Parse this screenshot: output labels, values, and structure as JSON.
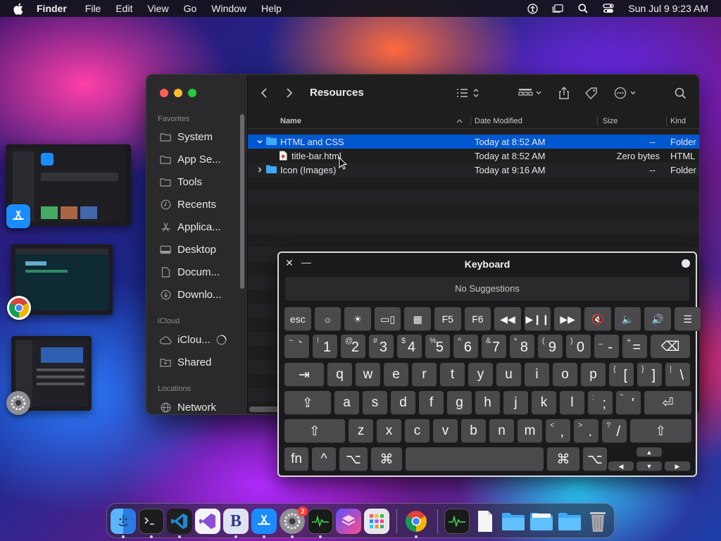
{
  "menubar": {
    "app_name": "Finder",
    "items": [
      "File",
      "Edit",
      "View",
      "Go",
      "Window",
      "Help"
    ],
    "clock": "Sun Jul 9  9:23 AM",
    "status_icons": [
      "accessibility-icon",
      "stage-manager-icon",
      "spotlight-icon",
      "control-center-icon"
    ]
  },
  "finder": {
    "title": "Resources",
    "sidebar": {
      "favorites_label": "Favorites",
      "favorites": [
        {
          "label": "System",
          "icon": "folder-icon"
        },
        {
          "label": "App Se...",
          "icon": "folder-icon"
        },
        {
          "label": "Tools",
          "icon": "folder-icon"
        },
        {
          "label": "Recents",
          "icon": "clock-icon"
        },
        {
          "label": "Applica...",
          "icon": "applications-icon"
        },
        {
          "label": "Desktop",
          "icon": "desktop-icon"
        },
        {
          "label": "Docum...",
          "icon": "document-icon"
        },
        {
          "label": "Downlo...",
          "icon": "download-icon"
        }
      ],
      "icloud_label": "iCloud",
      "icloud": [
        {
          "label": "iClou...",
          "icon": "cloud-icon"
        },
        {
          "label": "Shared",
          "icon": "shared-folder-icon"
        }
      ],
      "locations_label": "Locations",
      "locations": [
        {
          "label": "Network",
          "icon": "globe-icon"
        }
      ]
    },
    "columns": {
      "name": "Name",
      "date": "Date Modified",
      "size": "Size",
      "kind": "Kind"
    },
    "rows": [
      {
        "name": "HTML and CSS",
        "date": "Today at 8:52 AM",
        "size": "--",
        "kind": "Folder"
      },
      {
        "name": "title-bar.html",
        "date": "Today at 8:52 AM",
        "size": "Zero bytes",
        "kind": "HTML"
      },
      {
        "name": "Icon (Images)",
        "date": "Today at 9:16 AM",
        "size": "--",
        "kind": "Folder"
      }
    ]
  },
  "keyboard": {
    "title": "Keyboard",
    "suggestions": "No Suggestions",
    "fn_row": [
      "esc",
      "☼",
      "☀",
      "▭▯",
      "▦",
      "F5",
      "F6",
      "◀◀",
      "▶❙❙",
      "▶▶",
      "🔇",
      "🔈",
      "🔊",
      "☰"
    ],
    "number_row": [
      {
        "sub": "~",
        "main": "`"
      },
      {
        "sub": "!",
        "main": "1"
      },
      {
        "sub": "@",
        "main": "2"
      },
      {
        "sub": "#",
        "main": "3"
      },
      {
        "sub": "$",
        "main": "4"
      },
      {
        "sub": "%",
        "main": "5"
      },
      {
        "sub": "^",
        "main": "6"
      },
      {
        "sub": "&",
        "main": "7"
      },
      {
        "sub": "*",
        "main": "8"
      },
      {
        "sub": "(",
        "main": "9"
      },
      {
        "sub": ")",
        "main": "0"
      },
      {
        "sub": "_",
        "main": "-"
      },
      {
        "sub": "+",
        "main": "="
      }
    ],
    "delete": "⌫",
    "tab": "⇥",
    "qwerty_row": [
      "q",
      "w",
      "e",
      "r",
      "t",
      "y",
      "u",
      "i",
      "o",
      "p"
    ],
    "qwerty_punct": [
      {
        "sub": "{",
        "main": "["
      },
      {
        "sub": "}",
        "main": "]"
      },
      {
        "sub": "|",
        "main": "\\"
      }
    ],
    "caps": "⇪",
    "asdf_row": [
      "a",
      "s",
      "d",
      "f",
      "g",
      "h",
      "j",
      "k",
      "l"
    ],
    "asdf_punct": [
      {
        "sub": ":",
        "main": ";"
      },
      {
        "sub": "\"",
        "main": "'"
      }
    ],
    "return": "⏎",
    "shift": "⇧",
    "zxcv_row": [
      "z",
      "x",
      "c",
      "v",
      "b",
      "n",
      "m"
    ],
    "zxcv_punct": [
      {
        "sub": "<",
        "main": ","
      },
      {
        "sub": ">",
        "main": "."
      },
      {
        "sub": "?",
        "main": "/"
      }
    ],
    "fn": "fn",
    "control": "^",
    "option": "⌥",
    "command": "⌘",
    "arrows": {
      "up": "▲",
      "left": "◀",
      "down": "▼",
      "right": "▶"
    }
  },
  "dock": {
    "apps": [
      "Finder",
      "Terminal",
      "VS Code",
      "Visual Studio",
      "BBEdit",
      "App Store",
      "System Settings",
      "Activity Monitor",
      "Shortcuts",
      "Launchpad",
      "Chrome",
      "Activity Monitor 2",
      "Document",
      "Folder 1",
      "Folder 2",
      "Folder 3",
      "Trash"
    ],
    "settings_badge": "2"
  },
  "colors": {
    "accent": "#0058d0",
    "folder": "#3fa9f5",
    "close": "#ff5f57",
    "minimize": "#febc2e",
    "zoom": "#28c840"
  }
}
